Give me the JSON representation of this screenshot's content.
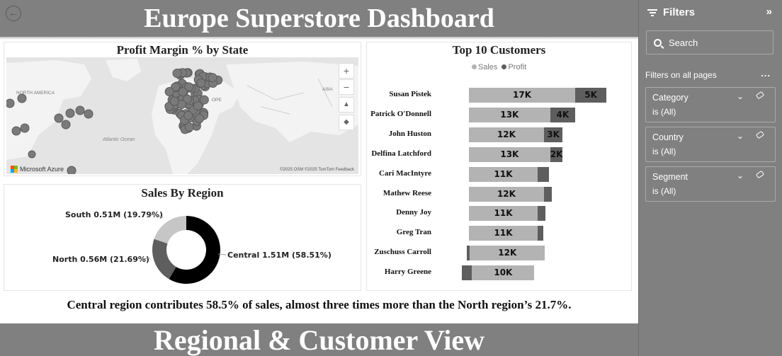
{
  "header": {
    "title": "Europe Superstore Dashboard",
    "back_icon": "back-arrow-icon"
  },
  "footer": {
    "subtitle": "Regional & Customer View"
  },
  "map_panel": {
    "title": "Profit Margin % by State",
    "labels": {
      "north_america": "NORTH AMERICA",
      "atlantic": "Atlantic Ocean",
      "asia": "ASIA",
      "europe": "OPE"
    },
    "zoom_in": "+",
    "zoom_out": "−",
    "brand": "Microsoft Azure",
    "credit": "©2025 OSM ©2025 TomTom  Feedback",
    "brand_colors": [
      "#f25022",
      "#7fba00",
      "#00a4ef",
      "#ffb900"
    ]
  },
  "region_panel": {
    "title": "Sales By Region",
    "chart_data": {
      "type": "pie",
      "donut": true,
      "slices": [
        {
          "label": "Central 1.51M (58.51%)",
          "value": 58.51,
          "color": "#000000"
        },
        {
          "label": "North 0.56M (21.69%)",
          "value": 21.69,
          "color": "#5e5e5e"
        },
        {
          "label": "South 0.51M (19.79%)",
          "value": 19.79,
          "color": "#c6c6c6"
        }
      ]
    }
  },
  "customers_panel": {
    "title": "Top 10 Customers",
    "chart_data": {
      "type": "bar",
      "orientation": "horizontal",
      "stacked": true,
      "categories": [
        "Susan Pistek",
        "Patrick O'Donnell",
        "John Huston",
        "Delfina Latchford",
        "Cari MacIntyre",
        "Mathew Reese",
        "Denny Joy",
        "Greg Tran",
        "Zuschuss Carroll",
        "Harry Greene"
      ],
      "series": [
        {
          "name": "Sales",
          "color": "#b3b3b3",
          "values": [
            17000,
            13000,
            12000,
            13000,
            11000,
            12000,
            11000,
            11000,
            12000,
            10000
          ],
          "labels": [
            "17K",
            "13K",
            "12K",
            "13K",
            "11K",
            "12K",
            "11K",
            "11K",
            "12K",
            "10K"
          ]
        },
        {
          "name": "Profit",
          "color": "#5e5e5e",
          "values": [
            5000,
            4000,
            3000,
            2000,
            1800,
            1300,
            1200,
            900,
            -500,
            -1600
          ],
          "labels": [
            "5K",
            "4K",
            "3K",
            "2K",
            "",
            "",
            "",
            "",
            "",
            ""
          ]
        }
      ]
    }
  },
  "insight": "Central region contributes 58.5% of sales, almost three times more than the North region’s 21.7%.",
  "filters": {
    "title": "Filters",
    "search_placeholder": "Search",
    "section_label": "Filters on all pages",
    "more": "...",
    "cards": [
      {
        "name": "Category",
        "value": "is (All)"
      },
      {
        "name": "Country",
        "value": "is (All)"
      },
      {
        "name": "Segment",
        "value": "is (All)"
      }
    ]
  }
}
